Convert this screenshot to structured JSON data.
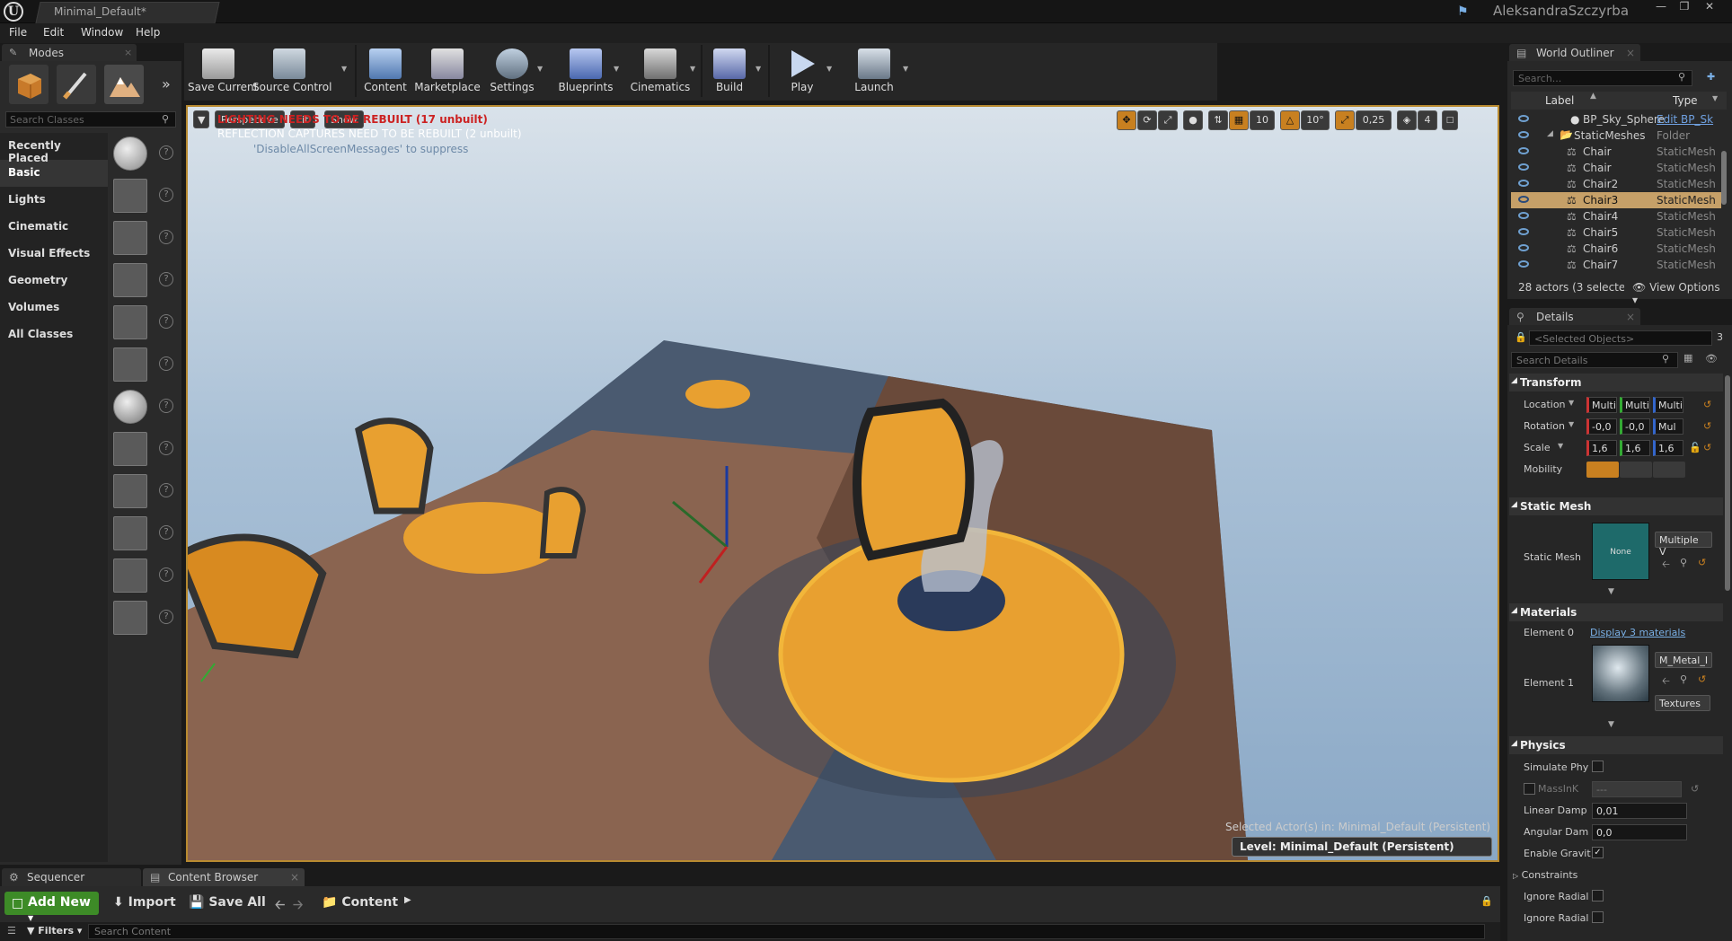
{
  "window": {
    "doc_tab": "Minimal_Default*",
    "user": "AleksandraSzczyrba"
  },
  "menu": [
    "File",
    "Edit",
    "Window",
    "Help"
  ],
  "modes": {
    "tab_label": "Modes",
    "search_placeholder": "Search Classes",
    "categories": [
      "Recently Placed",
      "Basic",
      "Lights",
      "Cinematic",
      "Visual Effects",
      "Geometry",
      "Volumes",
      "All Classes"
    ],
    "active_category": "Basic"
  },
  "toolbar": {
    "save_current": "Save Current",
    "source_control": "Source Control",
    "content": "Content",
    "marketplace": "Marketplace",
    "settings": "Settings",
    "blueprints": "Blueprints",
    "cinematics": "Cinematics",
    "build": "Build",
    "play": "Play",
    "launch": "Launch"
  },
  "viewport": {
    "perspective": "Perspective",
    "lit": "Lit",
    "show": "Show",
    "msg_lighting": "LIGHTING NEEDS TO BE REBUILT (17 unbuilt)",
    "msg_reflection": "REFLECTION CAPTURES NEED TO BE REBUILT (2 unbuilt)",
    "msg_suppress": "'DisableAllScreenMessages' to suppress",
    "grid_snap": "10",
    "rotation_snap": "10°",
    "scale_snap": "0,25",
    "camera_speed": "4",
    "selected_actors": "Selected Actor(s) in:  Minimal_Default (Persistent)",
    "level_label": "Level:",
    "level_value": "Minimal_Default (Persistent)"
  },
  "bottom": {
    "tab_sequencer": "Sequencer",
    "tab_content_browser": "Content Browser",
    "add_new": "Add New",
    "import": "Import",
    "save_all": "Save All",
    "path": "Content",
    "filters": "Filters",
    "search_placeholder": "Search Content"
  },
  "outliner": {
    "tab_label": "World Outliner",
    "search_placeholder": "Search...",
    "col_label": "Label",
    "col_type": "Type",
    "rows": [
      {
        "label": "BP_Sky_Sphere",
        "type": "Edit BP_Sk"
      },
      {
        "label": "StaticMeshes",
        "type": "Folder"
      },
      {
        "label": "Chair",
        "type": "StaticMesh"
      },
      {
        "label": "Chair",
        "type": "StaticMesh"
      },
      {
        "label": "Chair2",
        "type": "StaticMesh"
      },
      {
        "label": "Chair3",
        "type": "StaticMesh"
      },
      {
        "label": "Chair4",
        "type": "StaticMesh"
      },
      {
        "label": "Chair5",
        "type": "StaticMesh"
      },
      {
        "label": "Chair6",
        "type": "StaticMesh"
      },
      {
        "label": "Chair7",
        "type": "StaticMesh"
      }
    ],
    "selected_row": "Chair3",
    "footer": "28 actors (3 selected)",
    "view_options": "View Options"
  },
  "details": {
    "tab_label": "Details",
    "selected_objects": "<Selected Objects>",
    "selected_count": "3",
    "search_placeholder": "Search Details",
    "transform": {
      "header": "Transform",
      "location_label": "Location",
      "location": [
        "Multi",
        "Multi",
        "Multi"
      ],
      "rotation_label": "Rotation",
      "rotation": [
        "-0,0",
        "-0,0",
        "Mul"
      ],
      "scale_label": "Scale",
      "scale": [
        "1,6",
        "1,6",
        "1,6"
      ],
      "mobility_label": "Mobility"
    },
    "static_mesh": {
      "header": "Static Mesh",
      "label": "Static Mesh",
      "thumb_text": "None",
      "value": "Multiple V"
    },
    "materials": {
      "header": "Materials",
      "element0": "Element 0",
      "display_link": "Display 3 materials",
      "element1": "Element 1",
      "element1_value": "M_Metal_I",
      "textures": "Textures"
    },
    "physics": {
      "header": "Physics",
      "simulate": "Simulate Phy",
      "mass": "MassInK",
      "mass_value": "---",
      "linear_damp": "Linear Damp",
      "linear_value": "0,01",
      "angular_damp": "Angular Dam",
      "angular_value": "0,0",
      "enable_gravity": "Enable Gravit",
      "constraints": "Constraints",
      "ignore1": "Ignore Radial",
      "ignore2": "Ignore Radial"
    }
  }
}
